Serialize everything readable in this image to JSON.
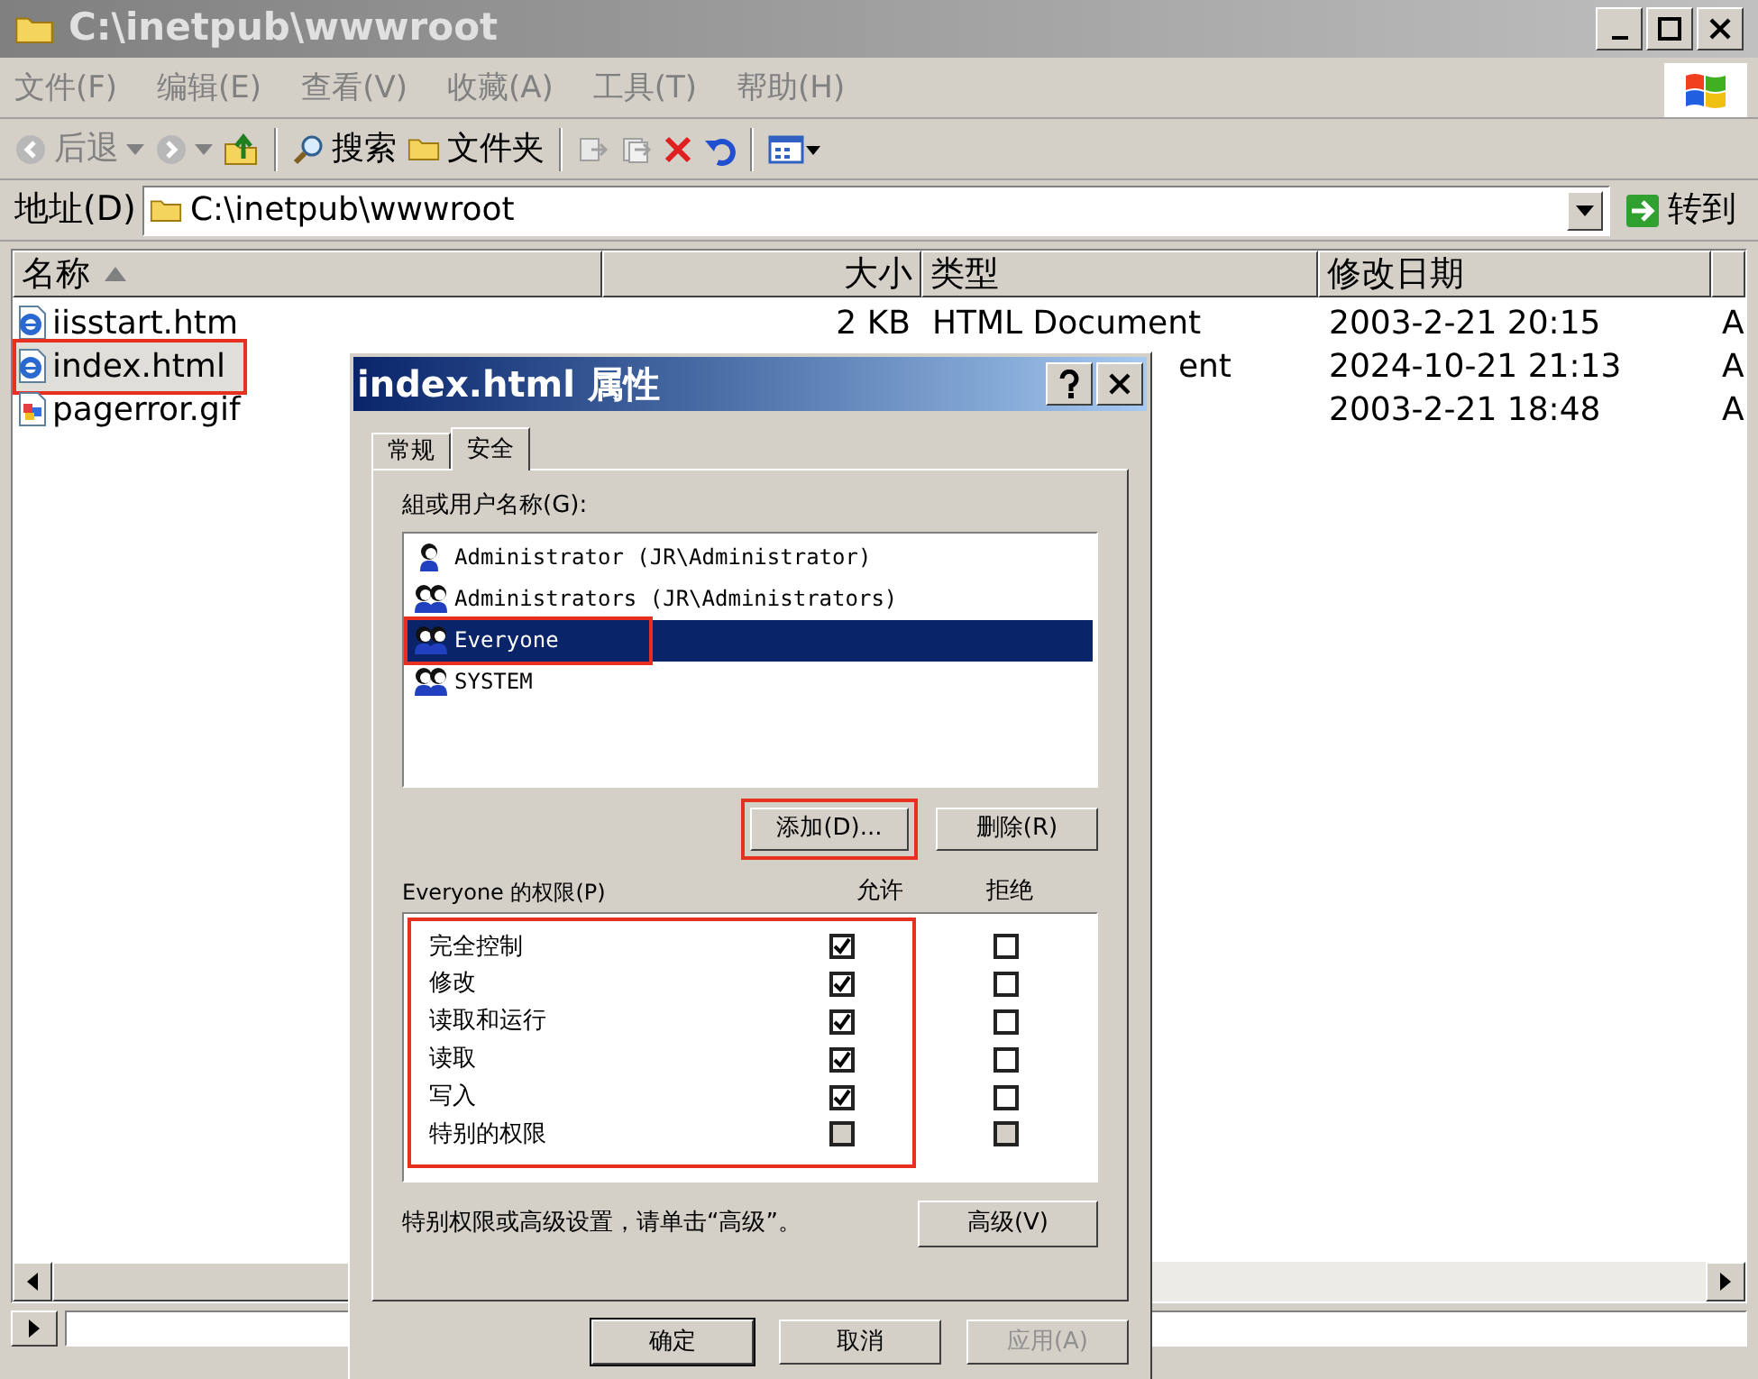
{
  "window": {
    "title": "C:\\inetpub\\wwwroot"
  },
  "menu": [
    "文件(F)",
    "编辑(E)",
    "查看(V)",
    "收藏(A)",
    "工具(T)",
    "帮助(H)"
  ],
  "toolbar": [
    {
      "kind": "back",
      "label": "后退"
    },
    {
      "kind": "forward"
    },
    {
      "kind": "up"
    },
    {
      "kind": "separator"
    },
    {
      "kind": "search",
      "label": "搜索"
    },
    {
      "kind": "folders",
      "label": "文件夹"
    },
    {
      "kind": "separator"
    },
    {
      "kind": "move"
    },
    {
      "kind": "copy"
    },
    {
      "kind": "delete"
    },
    {
      "kind": "undo"
    },
    {
      "kind": "separator"
    },
    {
      "kind": "views"
    }
  ],
  "address": {
    "label": "地址(D)",
    "value": "C:\\inetpub\\wwwroot",
    "go": "转到"
  },
  "columns": [
    {
      "label": "名称",
      "sorted": true
    },
    {
      "label": "大小",
      "sorted": false
    },
    {
      "label": "类型",
      "sorted": false
    },
    {
      "label": "修改日期",
      "sorted": false
    }
  ],
  "rows": [
    {
      "name": "iisstart.htm",
      "kind": "web",
      "size": "2 KB",
      "type": "HTML Document",
      "type_cut": false,
      "date": "2003-2-21 20:15",
      "column_5": "A",
      "selected": false,
      "marked": false
    },
    {
      "name": "index.html",
      "kind": "web",
      "type": "ent",
      "type_cut": true,
      "date": "2024-10-21 21:13",
      "column_5": "A",
      "selected": true,
      "marked": true
    },
    {
      "name": "pagerror.gif",
      "kind": "image",
      "date": "2003-2-21 18:48",
      "column_5": "A",
      "selected": false,
      "marked": false
    }
  ],
  "dialog": {
    "title": "index.html 属性",
    "tabs": [
      {
        "label": "常规",
        "selected": false
      },
      {
        "label": "安全",
        "selected": true
      }
    ],
    "users_label": "組或用户名称(G):",
    "users": [
      {
        "name": "Administrator (JR\\Administrator)",
        "kind": "user",
        "selected": false,
        "marked": false
      },
      {
        "name": "Administrators (JR\\Administrators)",
        "kind": "group",
        "selected": false,
        "marked": false
      },
      {
        "name": "Everyone",
        "kind": "group",
        "selected": true,
        "marked": true
      },
      {
        "name": "SYSTEM",
        "kind": "group",
        "selected": false,
        "marked": false
      }
    ],
    "add_button": {
      "label": "添加(D)...",
      "marked": true
    },
    "remove_button": "删除(R)",
    "permissions_label": "Everyone 的权限(P)",
    "allow_header": "允许",
    "deny_header": "拒绝",
    "permissions_marked": true,
    "permissions": [
      {
        "name": "完全控制",
        "allow": true,
        "allow_disabled": false,
        "deny": false,
        "deny_disabled": false
      },
      {
        "name": "修改",
        "allow": true,
        "allow_disabled": false,
        "deny": false,
        "deny_disabled": false
      },
      {
        "name": "读取和运行",
        "allow": true,
        "allow_disabled": false,
        "deny": false,
        "deny_disabled": false
      },
      {
        "name": "读取",
        "allow": true,
        "allow_disabled": false,
        "deny": false,
        "deny_disabled": false
      },
      {
        "name": "写入",
        "allow": true,
        "allow_disabled": false,
        "deny": false,
        "deny_disabled": false
      },
      {
        "name": "特别的权限",
        "allow": false,
        "allow_disabled": true,
        "deny": false,
        "deny_disabled": true
      }
    ],
    "advanced_note": "特别权限或高级设置，请单击“高级”。",
    "advanced_button": "高级(V)",
    "buttons": [
      {
        "label": "确定",
        "default": true,
        "disabled": false
      },
      {
        "label": "取消",
        "default": false,
        "disabled": false
      },
      {
        "label": "应用(A)",
        "default": false,
        "disabled": true
      }
    ]
  }
}
